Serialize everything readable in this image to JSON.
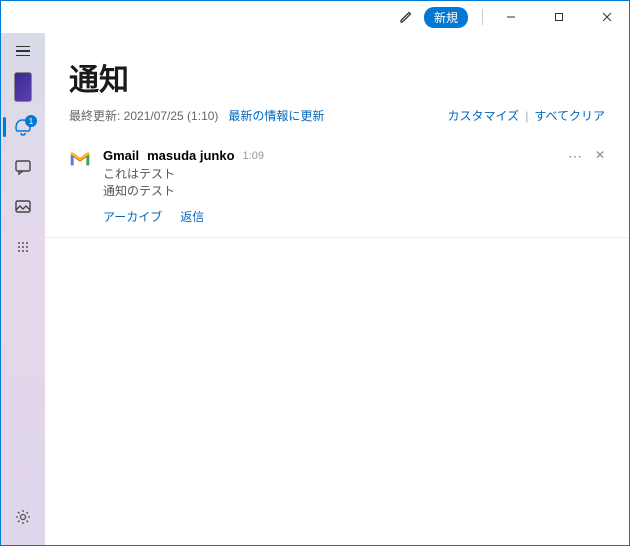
{
  "titlebar": {
    "new_label": "新規"
  },
  "sidebar": {
    "badge_count": "1"
  },
  "header": {
    "title": "通知",
    "last_updated": "最終更新: 2021/07/25 (1:10)",
    "refresh": "最新の情報に更新",
    "customize": "カスタマイズ",
    "clear_all": "すべてクリア"
  },
  "notification": {
    "app": "Gmail",
    "sender": "masuda junko",
    "time": "1:09",
    "line1": "これはテスト",
    "line2": "通知のテスト",
    "archive": "アーカイブ",
    "reply": "返信",
    "more": "⋯",
    "close": "✕"
  }
}
